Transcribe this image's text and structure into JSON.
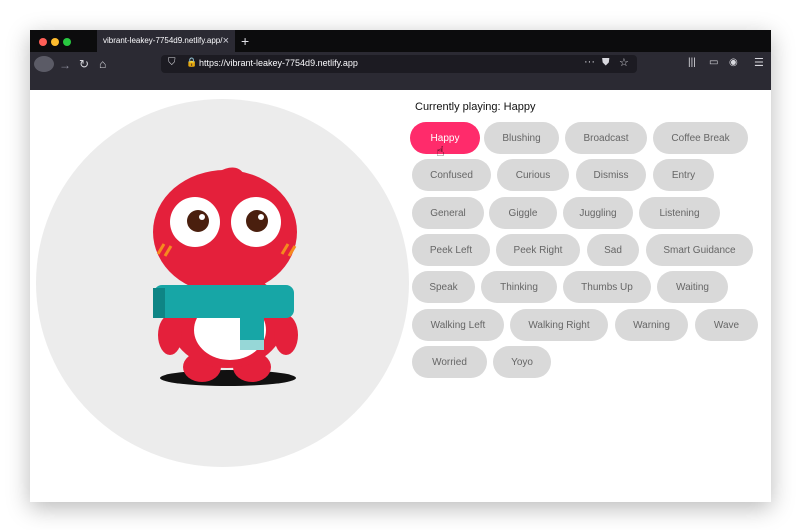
{
  "browser": {
    "tab_title": "vibrant-leakey-7754d9.netlify.app/",
    "tab_close": "×",
    "new_tab": "+",
    "url": "https://vibrant-leakey-7754d9.netlify.app",
    "url_more": "···"
  },
  "player": {
    "currently_playing": "Currently playing: Happy",
    "animations": [
      {
        "label": "Happy",
        "active": true
      },
      {
        "label": "Blushing"
      },
      {
        "label": "Broadcast"
      },
      {
        "label": "Coffee Break"
      },
      {
        "label": "Confused"
      },
      {
        "label": "Curious"
      },
      {
        "label": "Dismiss"
      },
      {
        "label": "Entry"
      },
      {
        "label": "General"
      },
      {
        "label": "Giggle"
      },
      {
        "label": "Juggling"
      },
      {
        "label": "Listening"
      },
      {
        "label": "Peek Left"
      },
      {
        "label": "Peek Right"
      },
      {
        "label": "Sad"
      },
      {
        "label": "Smart Guidance"
      },
      {
        "label": "Speak"
      },
      {
        "label": "Thinking"
      },
      {
        "label": "Thumbs Up"
      },
      {
        "label": "Waiting"
      },
      {
        "label": "Walking Left"
      },
      {
        "label": "Walking Right"
      },
      {
        "label": "Warning"
      },
      {
        "label": "Wave"
      },
      {
        "label": "Worried"
      },
      {
        "label": "Yoyo"
      }
    ]
  },
  "colors": {
    "active_pill": "#ff2b6b",
    "pill": "#d9d9d9",
    "character_red": "#e4203b",
    "scarf_teal": "#17a6a6"
  }
}
